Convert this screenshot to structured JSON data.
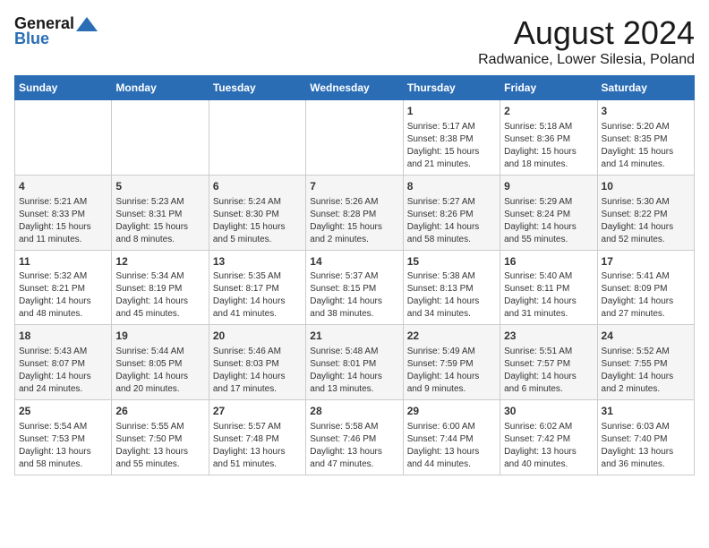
{
  "header": {
    "logo_general": "General",
    "logo_blue": "Blue",
    "month_title": "August 2024",
    "location": "Radwanice, Lower Silesia, Poland"
  },
  "calendar": {
    "days_of_week": [
      "Sunday",
      "Monday",
      "Tuesday",
      "Wednesday",
      "Thursday",
      "Friday",
      "Saturday"
    ],
    "weeks": [
      [
        {
          "day": "",
          "info": ""
        },
        {
          "day": "",
          "info": ""
        },
        {
          "day": "",
          "info": ""
        },
        {
          "day": "",
          "info": ""
        },
        {
          "day": "1",
          "info": "Sunrise: 5:17 AM\nSunset: 8:38 PM\nDaylight: 15 hours and 21 minutes."
        },
        {
          "day": "2",
          "info": "Sunrise: 5:18 AM\nSunset: 8:36 PM\nDaylight: 15 hours and 18 minutes."
        },
        {
          "day": "3",
          "info": "Sunrise: 5:20 AM\nSunset: 8:35 PM\nDaylight: 15 hours and 14 minutes."
        }
      ],
      [
        {
          "day": "4",
          "info": "Sunrise: 5:21 AM\nSunset: 8:33 PM\nDaylight: 15 hours and 11 minutes."
        },
        {
          "day": "5",
          "info": "Sunrise: 5:23 AM\nSunset: 8:31 PM\nDaylight: 15 hours and 8 minutes."
        },
        {
          "day": "6",
          "info": "Sunrise: 5:24 AM\nSunset: 8:30 PM\nDaylight: 15 hours and 5 minutes."
        },
        {
          "day": "7",
          "info": "Sunrise: 5:26 AM\nSunset: 8:28 PM\nDaylight: 15 hours and 2 minutes."
        },
        {
          "day": "8",
          "info": "Sunrise: 5:27 AM\nSunset: 8:26 PM\nDaylight: 14 hours and 58 minutes."
        },
        {
          "day": "9",
          "info": "Sunrise: 5:29 AM\nSunset: 8:24 PM\nDaylight: 14 hours and 55 minutes."
        },
        {
          "day": "10",
          "info": "Sunrise: 5:30 AM\nSunset: 8:22 PM\nDaylight: 14 hours and 52 minutes."
        }
      ],
      [
        {
          "day": "11",
          "info": "Sunrise: 5:32 AM\nSunset: 8:21 PM\nDaylight: 14 hours and 48 minutes."
        },
        {
          "day": "12",
          "info": "Sunrise: 5:34 AM\nSunset: 8:19 PM\nDaylight: 14 hours and 45 minutes."
        },
        {
          "day": "13",
          "info": "Sunrise: 5:35 AM\nSunset: 8:17 PM\nDaylight: 14 hours and 41 minutes."
        },
        {
          "day": "14",
          "info": "Sunrise: 5:37 AM\nSunset: 8:15 PM\nDaylight: 14 hours and 38 minutes."
        },
        {
          "day": "15",
          "info": "Sunrise: 5:38 AM\nSunset: 8:13 PM\nDaylight: 14 hours and 34 minutes."
        },
        {
          "day": "16",
          "info": "Sunrise: 5:40 AM\nSunset: 8:11 PM\nDaylight: 14 hours and 31 minutes."
        },
        {
          "day": "17",
          "info": "Sunrise: 5:41 AM\nSunset: 8:09 PM\nDaylight: 14 hours and 27 minutes."
        }
      ],
      [
        {
          "day": "18",
          "info": "Sunrise: 5:43 AM\nSunset: 8:07 PM\nDaylight: 14 hours and 24 minutes."
        },
        {
          "day": "19",
          "info": "Sunrise: 5:44 AM\nSunset: 8:05 PM\nDaylight: 14 hours and 20 minutes."
        },
        {
          "day": "20",
          "info": "Sunrise: 5:46 AM\nSunset: 8:03 PM\nDaylight: 14 hours and 17 minutes."
        },
        {
          "day": "21",
          "info": "Sunrise: 5:48 AM\nSunset: 8:01 PM\nDaylight: 14 hours and 13 minutes."
        },
        {
          "day": "22",
          "info": "Sunrise: 5:49 AM\nSunset: 7:59 PM\nDaylight: 14 hours and 9 minutes."
        },
        {
          "day": "23",
          "info": "Sunrise: 5:51 AM\nSunset: 7:57 PM\nDaylight: 14 hours and 6 minutes."
        },
        {
          "day": "24",
          "info": "Sunrise: 5:52 AM\nSunset: 7:55 PM\nDaylight: 14 hours and 2 minutes."
        }
      ],
      [
        {
          "day": "25",
          "info": "Sunrise: 5:54 AM\nSunset: 7:53 PM\nDaylight: 13 hours and 58 minutes."
        },
        {
          "day": "26",
          "info": "Sunrise: 5:55 AM\nSunset: 7:50 PM\nDaylight: 13 hours and 55 minutes."
        },
        {
          "day": "27",
          "info": "Sunrise: 5:57 AM\nSunset: 7:48 PM\nDaylight: 13 hours and 51 minutes."
        },
        {
          "day": "28",
          "info": "Sunrise: 5:58 AM\nSunset: 7:46 PM\nDaylight: 13 hours and 47 minutes."
        },
        {
          "day": "29",
          "info": "Sunrise: 6:00 AM\nSunset: 7:44 PM\nDaylight: 13 hours and 44 minutes."
        },
        {
          "day": "30",
          "info": "Sunrise: 6:02 AM\nSunset: 7:42 PM\nDaylight: 13 hours and 40 minutes."
        },
        {
          "day": "31",
          "info": "Sunrise: 6:03 AM\nSunset: 7:40 PM\nDaylight: 13 hours and 36 minutes."
        }
      ]
    ]
  }
}
